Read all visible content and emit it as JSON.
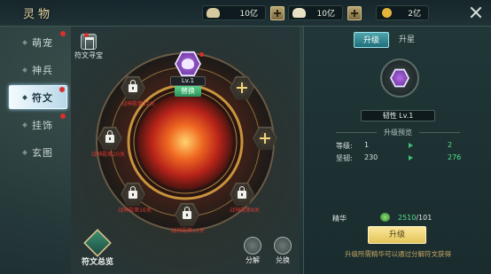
{
  "header": {
    "title": "灵物",
    "currencies": [
      {
        "icon": "silver-ingot-icon",
        "value": "10亿",
        "color": "#d7c9a0"
      },
      {
        "icon": "scroll-icon",
        "value": "10亿",
        "color": "#e7e2c6"
      },
      {
        "icon": "gold-coin-icon",
        "value": "2亿",
        "color": "#e5b53a"
      }
    ]
  },
  "sidebar": {
    "items": [
      {
        "label": "萌宠",
        "badge": true
      },
      {
        "label": "神兵",
        "badge": false
      },
      {
        "label": "符文",
        "badge": true,
        "active": true
      },
      {
        "label": "挂饰",
        "badge": true
      },
      {
        "label": "玄图",
        "badge": false
      }
    ]
  },
  "center": {
    "seek_label": "符文寻宝",
    "equipped_level": "Lv.1",
    "replace_label": "替换",
    "locked_slots": [
      {
        "label": "战神殿第12关"
      },
      {
        "label": "战神殿第20关"
      },
      {
        "label": "战神殿第16关"
      },
      {
        "label": "战神殿第12关"
      },
      {
        "label": "战神殿第8关"
      }
    ],
    "overview_label": "符文总览",
    "decompose_label": "分解",
    "exchange_label": "兑换"
  },
  "detail": {
    "tabs": [
      {
        "label": "升级",
        "active": true
      },
      {
        "label": "升星",
        "active": false
      }
    ],
    "rune_name": "韧性 Lv.1",
    "preview_header": "升级预览",
    "stats": [
      {
        "label": "等级:",
        "current": "1",
        "next": "2"
      },
      {
        "label": "坚韧:",
        "current": "230",
        "next": "276"
      }
    ],
    "essence_label": "精华",
    "essence_have": "2510",
    "essence_need": "/101",
    "upgrade_button": "升级",
    "hint": "升级所需精华可以通过分解符文获得"
  },
  "colors": {
    "accent_gold": "#e3c45a",
    "locked_text_red": "#d43a33",
    "upgrade_green": "#54e08c",
    "essence_green": "#3fbf7a",
    "rune_purple": "#9b4fd6"
  }
}
